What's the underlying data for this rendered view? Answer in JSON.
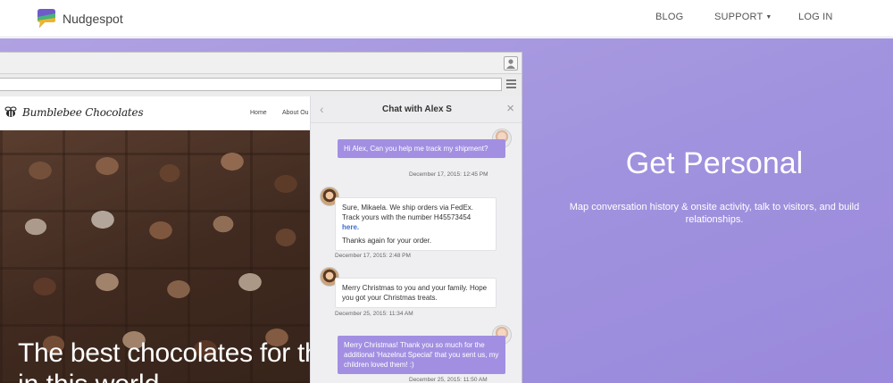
{
  "nav": {
    "brand": "Nudgespot",
    "blog": "BLOG",
    "support": "SUPPORT",
    "login": "LOG IN"
  },
  "hero": {
    "title": "Get Personal",
    "description": "Map conversation history & onsite activity, talk to visitors, and build relationships."
  },
  "site": {
    "logo": "Bumblebee Chocolates",
    "nav": [
      "Home",
      "About Ou"
    ],
    "headline_line1": "The best chocolates for th",
    "headline_line2": "in this world..."
  },
  "chat": {
    "title": "Chat with Alex S",
    "messages": [
      {
        "from": "Alex",
        "text": "Hi Alex, Can you help me track my shipment?",
        "time": "December 17, 2015: 12:45 PM"
      },
      {
        "from": "Mikaela",
        "text_before_link": "Sure, Mikaela. We ship orders via FedEx. Track yours with the number H45573454 ",
        "link": "here.",
        "text_after": "Thanks again for your order.",
        "time": "December 17, 2015: 2:48 PM"
      },
      {
        "from": "Mikaela",
        "text": "Merry Christmas to you and your family. Hope you got your Christmas treats.",
        "time": "December 25, 2015: 11:34 AM"
      },
      {
        "from": "Alex",
        "text": "Merry Christmas! Thank you so much for the additional 'Hazelnut Special' that you sent us, my children loved them! :)",
        "time": "December 25, 2015: 11:50 AM"
      }
    ]
  },
  "colors": {
    "hero_bg": "#a193de",
    "bubble_out": "#a28fe2",
    "link": "#3a6ed2"
  },
  "icons": [
    "logo-icon",
    "caret-down-icon",
    "user-icon",
    "menu-icon",
    "bee-icon",
    "chevron-left-icon",
    "close-icon"
  ]
}
